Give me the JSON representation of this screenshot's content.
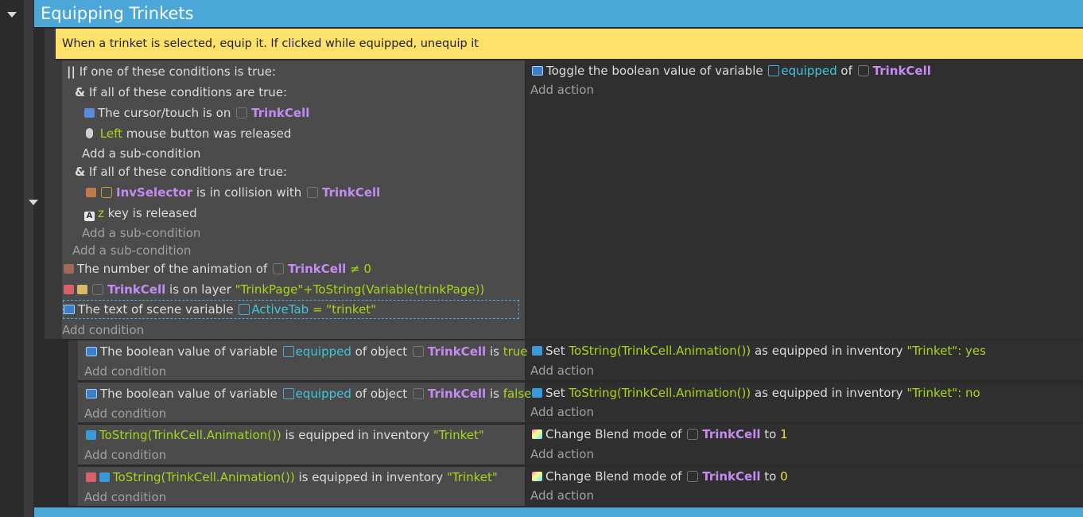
{
  "event": {
    "title": "Equipping Trinkets",
    "comment": "When a trinket is selected, equip it. If clicked while equipped, unequip it"
  },
  "main": {
    "or_header": "If one of these conditions is true:",
    "and1_header": "If all of these conditions are true:",
    "and1_c1_pre": "The cursor/touch is on",
    "and1_c1_obj": "TrinkCell",
    "and1_c2_key": "Left",
    "and1_c2_rest": "mouse button was released",
    "add_sub_condition": "Add a sub-condition",
    "and2_header": "If all of these conditions are true:",
    "and2_c1_obj": "InvSelector",
    "and2_c1_mid": "is in collision with",
    "and2_c1_obj2": "TrinkCell",
    "and2_c2_key": "z",
    "and2_c2_rest": "key is released",
    "c_anim_pre": "The number of the animation of",
    "c_anim_obj": "TrinkCell",
    "c_anim_op": "≠ 0",
    "c_layer_obj": "TrinkCell",
    "c_layer_mid": "is on layer",
    "c_layer_expr": "\"TrinkPage\"+ToString(Variable(trinkPage))",
    "c_scene_pre": "The text of scene variable",
    "c_scene_var": "ActiveTab",
    "c_scene_op": "=",
    "c_scene_val": "\"trinket\"",
    "add_condition": "Add condition",
    "action1_pre": "Toggle the boolean value of variable",
    "action1_var": "equipped",
    "action1_of": "of",
    "action1_obj": "TrinkCell",
    "add_action": "Add action"
  },
  "subs": [
    {
      "cond_pre": "The boolean value of variable",
      "cond_var": "equipped",
      "cond_mid": "of object",
      "cond_obj": "TrinkCell",
      "cond_is": "is",
      "cond_val": "true",
      "act_pre": "Set",
      "act_expr": "ToString(TrinkCell.Animation())",
      "act_mid": "as equipped in inventory",
      "act_inv": "\"Trinket\"",
      "act_val": ": yes"
    },
    {
      "cond_pre": "The boolean value of variable",
      "cond_var": "equipped",
      "cond_mid": "of object",
      "cond_obj": "TrinkCell",
      "cond_is": "is",
      "cond_val": "false",
      "act_pre": "Set",
      "act_expr": "ToString(TrinkCell.Animation())",
      "act_mid": "as equipped in inventory",
      "act_inv": "\"Trinket\"",
      "act_val": ": no"
    },
    {
      "cond_expr": "ToString(TrinkCell.Animation())",
      "cond_mid": "is equipped in inventory",
      "cond_inv": "\"Trinket\"",
      "act_pre": "Change Blend mode of",
      "act_obj": "TrinkCell",
      "act_to": "to",
      "act_val": "1"
    },
    {
      "cond_expr": "ToString(TrinkCell.Animation())",
      "cond_mid": "is equipped in inventory",
      "cond_inv": "\"Trinket\"",
      "act_pre": "Change Blend mode of",
      "act_obj": "TrinkCell",
      "act_to": "to",
      "act_val": "0"
    }
  ],
  "colors": {
    "header": "#4aa7d8",
    "comment": "#fde16a",
    "object": "#c58bf2",
    "value": "#a8d41c",
    "variable": "#3fc5e0",
    "number": "#f0e040"
  }
}
